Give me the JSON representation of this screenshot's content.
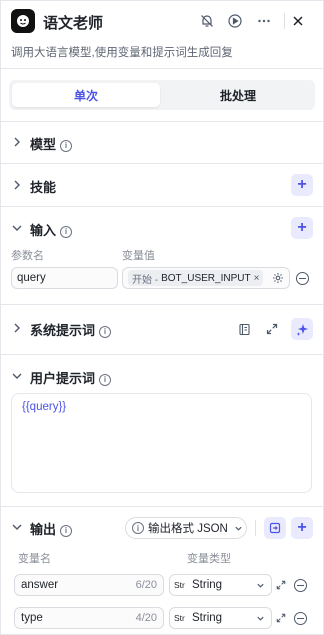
{
  "header": {
    "title": "语文老师",
    "description": "调用大语言模型,使用变量和提示词生成回复"
  },
  "tabs": [
    {
      "label": "单次"
    },
    {
      "label": "批处理"
    }
  ],
  "sections": {
    "model": {
      "title": "模型"
    },
    "skills": {
      "title": "技能"
    },
    "input": {
      "title": "输入",
      "col_name": "参数名",
      "col_value": "变量值",
      "param_name": "query",
      "value_prefix": "开始 -",
      "value_var": "BOT_USER_INPUT"
    },
    "system_prompt": {
      "title": "系统提示词"
    },
    "user_prompt": {
      "title": "用户提示词",
      "content": "{{query}}"
    },
    "output": {
      "title": "输出",
      "format_label": "输出格式 JSON",
      "col_name": "变量名",
      "col_type": "变量类型",
      "rows": [
        {
          "name": "answer",
          "count": "6/20",
          "type_prefix": "Str",
          "type": "String"
        },
        {
          "name": "type",
          "count": "4/20",
          "type_prefix": "Str",
          "type": "String"
        }
      ]
    }
  },
  "colors": {
    "accent": "#4d53e8",
    "accent_bg": "#e9eafd"
  }
}
